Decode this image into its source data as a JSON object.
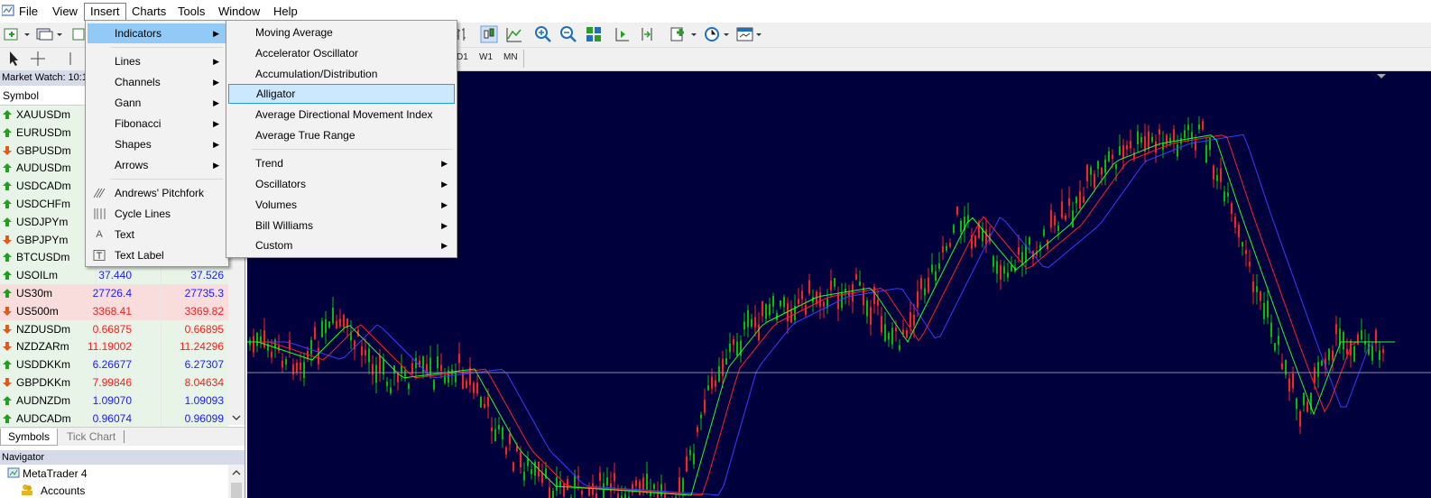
{
  "menubar": {
    "items": [
      "File",
      "View",
      "Insert",
      "Charts",
      "Tools",
      "Window",
      "Help"
    ]
  },
  "timeframes": [
    "D1",
    "W1",
    "MN"
  ],
  "market_watch": {
    "title": "Market Watch: 10:1",
    "column_symbol": "Symbol",
    "rows": [
      {
        "symbol": "XAUUSDm",
        "bid": "",
        "ask": "",
        "dir": "up",
        "bg": "#e8f4e8"
      },
      {
        "symbol": "EURUSDm",
        "bid": "",
        "ask": "",
        "dir": "up",
        "bg": "#e8f4e8"
      },
      {
        "symbol": "GBPUSDm",
        "bid": "",
        "ask": "",
        "dir": "down",
        "bg": "#e8f4e8"
      },
      {
        "symbol": "AUDUSDm",
        "bid": "",
        "ask": "",
        "dir": "up",
        "bg": "#e8f4e8"
      },
      {
        "symbol": "USDCADm",
        "bid": "",
        "ask": "",
        "dir": "up",
        "bg": "#e8f4e8"
      },
      {
        "symbol": "USDCHFm",
        "bid": "",
        "ask": "",
        "dir": "up",
        "bg": "#e8f4e8"
      },
      {
        "symbol": "USDJPYm",
        "bid": "",
        "ask": "",
        "dir": "up",
        "bg": "#e8f4e8"
      },
      {
        "symbol": "GBPJPYm",
        "bid": "",
        "ask": "",
        "dir": "down",
        "bg": "#e8f4e8"
      },
      {
        "symbol": "BTCUSDm",
        "bid": "",
        "ask": "",
        "dir": "up",
        "bg": "#e8f4e8"
      },
      {
        "symbol": "USOILm",
        "bid": "37.440",
        "ask": "37.526",
        "dir": "up",
        "bg": "#e8f4e8",
        "color": "#1a1aff"
      },
      {
        "symbol": "US30m",
        "bid": "27726.4",
        "ask": "27735.3",
        "dir": "up",
        "bg": "#f9dcdc",
        "color": "#1a1aff"
      },
      {
        "symbol": "US500m",
        "bid": "3368.41",
        "ask": "3369.82",
        "dir": "down",
        "bg": "#f9dcdc",
        "color": "#ff1a1a"
      },
      {
        "symbol": "NZDUSDm",
        "bid": "0.66875",
        "ask": "0.66895",
        "dir": "down",
        "bg": "#e8f4e8",
        "color": "#ff1a1a"
      },
      {
        "symbol": "NZDZARm",
        "bid": "11.19002",
        "ask": "11.24296",
        "dir": "down",
        "bg": "#e8f4e8",
        "color": "#ff1a1a"
      },
      {
        "symbol": "USDDKKm",
        "bid": "6.26677",
        "ask": "6.27307",
        "dir": "up",
        "bg": "#e8f4e8",
        "color": "#1a1aff"
      },
      {
        "symbol": "GBPDKKm",
        "bid": "7.99846",
        "ask": "8.04634",
        "dir": "down",
        "bg": "#e8f4e8",
        "color": "#ff1a1a"
      },
      {
        "symbol": "AUDNZDm",
        "bid": "1.09070",
        "ask": "1.09093",
        "dir": "up",
        "bg": "#e8f4e8",
        "color": "#1a1aff"
      },
      {
        "symbol": "AUDCADm",
        "bid": "0.96074",
        "ask": "0.96099",
        "dir": "up",
        "bg": "#e8f4e8",
        "color": "#1a1aff"
      }
    ],
    "tabs": [
      "Symbols",
      "Tick Chart"
    ]
  },
  "navigator": {
    "title": "Navigator",
    "items": [
      "MetaTrader 4",
      "Accounts"
    ]
  },
  "insert_menu": {
    "items": [
      "Indicators",
      "Lines",
      "Channels",
      "Gann",
      "Fibonacci",
      "Shapes",
      "Arrows",
      "Andrews' Pitchfork",
      "Cycle Lines",
      "Text",
      "Text Label"
    ],
    "icons": [
      "",
      "",
      "",
      "",
      "",
      "",
      "",
      "//",
      "|||",
      "A",
      "T"
    ]
  },
  "indicators_menu": {
    "items": [
      "Moving Average",
      "Accelerator Oscillator",
      "Accumulation/Distribution",
      "Alligator",
      "Average Directional Movement Index",
      "Average True Range",
      "Trend",
      "Oscillators",
      "Volumes",
      "Bill Williams",
      "Custom"
    ],
    "highlighted": "Alligator"
  },
  "colors": {
    "chart_bg": "#00003c",
    "bull_candle": "#00c000",
    "bear_candle": "#ff2020",
    "jaw_line": "#3c3cff",
    "teeth_line": "#ff2020",
    "lips_line": "#20ff20",
    "menu_highlight": "#91c9f7"
  }
}
